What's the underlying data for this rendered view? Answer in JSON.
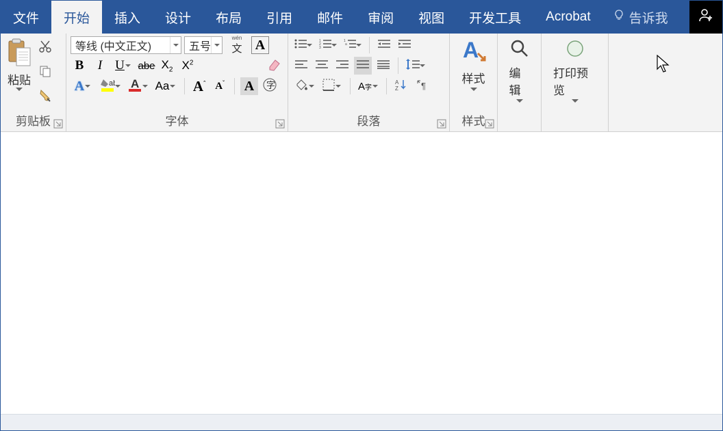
{
  "tabs": {
    "file": "文件",
    "home": "开始",
    "insert": "插入",
    "design": "设计",
    "layout": "布局",
    "references": "引用",
    "mailings": "邮件",
    "review": "审阅",
    "view": "视图",
    "developer": "开发工具",
    "acrobat": "Acrobat"
  },
  "tell_me": "告诉我",
  "clipboard": {
    "paste": "粘贴",
    "label": "剪贴板"
  },
  "font": {
    "name": "等线 (中文正文)",
    "size": "五号",
    "wen": "wén",
    "label": "字体"
  },
  "paragraph": {
    "label": "段落"
  },
  "styles": {
    "button": "样式",
    "label": "样式"
  },
  "editing": {
    "button": "编辑"
  },
  "print": {
    "button": "打印预览"
  }
}
